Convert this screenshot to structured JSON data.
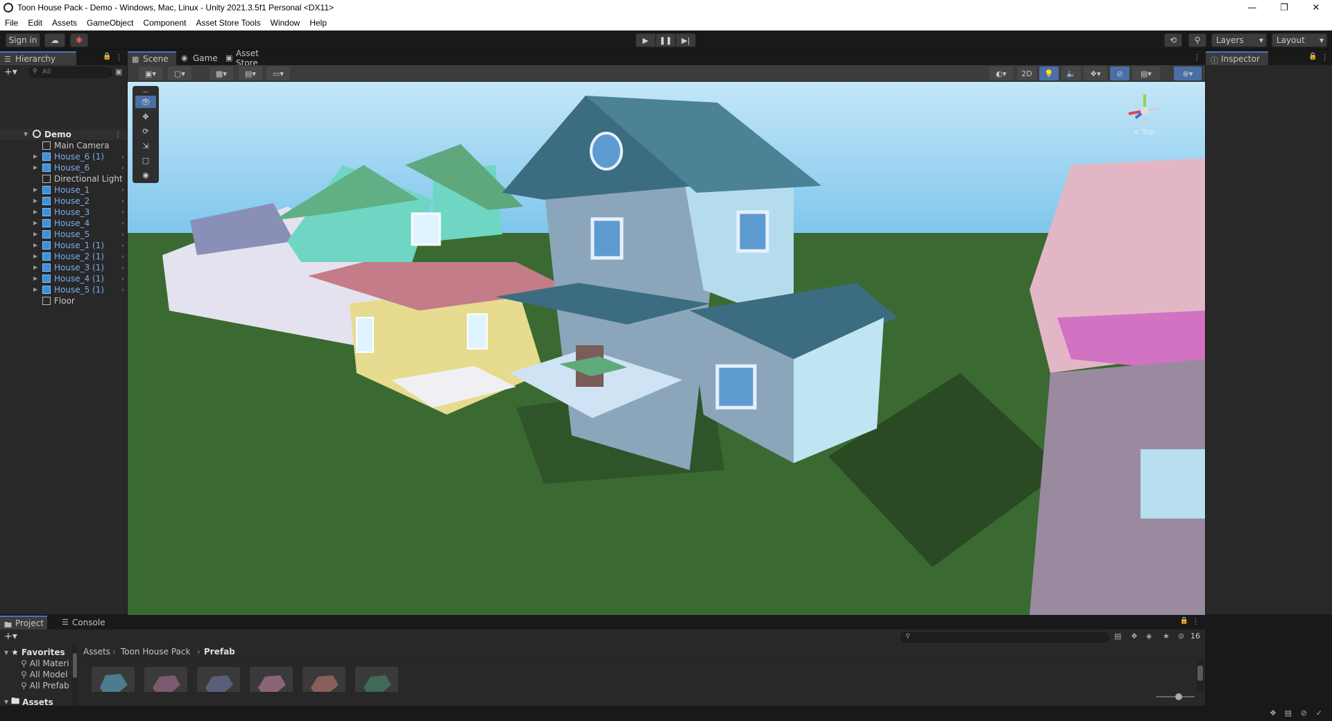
{
  "window": {
    "title": "Toon House Pack - Demo - Windows, Mac, Linux - Unity 2021.3.5f1 Personal <DX11>",
    "controls": [
      "minimize",
      "restore",
      "close"
    ]
  },
  "menu": [
    "File",
    "Edit",
    "Assets",
    "GameObject",
    "Component",
    "Asset Store Tools",
    "Window",
    "Help"
  ],
  "toolbar": {
    "sign_in": "Sign in",
    "layers": "Layers",
    "layout": "Layout"
  },
  "hierarchy": {
    "tab": "Hierarchy",
    "search_placeholder": "All",
    "scene": "Demo",
    "items": [
      {
        "label": "Main Camera",
        "prefab": false,
        "expandable": false
      },
      {
        "label": "House_6 (1)",
        "prefab": true,
        "expandable": true
      },
      {
        "label": "House_6",
        "prefab": true,
        "expandable": true
      },
      {
        "label": "Directional Light",
        "prefab": false,
        "expandable": false
      },
      {
        "label": "House_1",
        "prefab": true,
        "expandable": true
      },
      {
        "label": "House_2",
        "prefab": true,
        "expandable": true
      },
      {
        "label": "House_3",
        "prefab": true,
        "expandable": true
      },
      {
        "label": "House_4",
        "prefab": true,
        "expandable": true
      },
      {
        "label": "House_5",
        "prefab": true,
        "expandable": true
      },
      {
        "label": "House_1 (1)",
        "prefab": true,
        "expandable": true
      },
      {
        "label": "House_2 (1)",
        "prefab": true,
        "expandable": true
      },
      {
        "label": "House_3 (1)",
        "prefab": true,
        "expandable": true
      },
      {
        "label": "House_4 (1)",
        "prefab": true,
        "expandable": true
      },
      {
        "label": "House_5 (1)",
        "prefab": true,
        "expandable": true
      },
      {
        "label": "Floor",
        "prefab": false,
        "expandable": false
      }
    ]
  },
  "center_tabs": [
    "Scene",
    "Game",
    "Asset Store"
  ],
  "scene_toolbar": {
    "mode_2d": "2D"
  },
  "gizmo": {
    "view_label": "< Top"
  },
  "inspector": {
    "tab": "Inspector"
  },
  "project": {
    "tabs": [
      "Project",
      "Console"
    ],
    "favorites_header": "Favorites",
    "favorites": [
      "All Materi",
      "All Model",
      "All Prefab"
    ],
    "assets_header": "Assets",
    "breadcrumb": [
      "Assets",
      "Toon House Pack",
      "Prefab"
    ],
    "hidden_count": "16"
  },
  "colors": {
    "accent": "#3a79bb",
    "prefab_text": "#7cabeb",
    "sky_top": "#c4e6f8",
    "sky_bottom": "#7ec6ec",
    "grass": "#3a6a32",
    "panel_bg": "#282828"
  }
}
